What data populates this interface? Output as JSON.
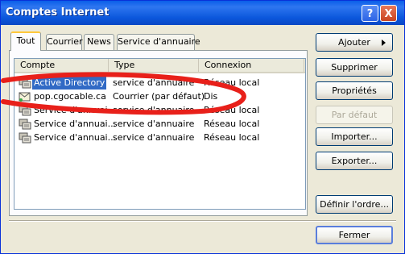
{
  "window": {
    "title": "Comptes Internet"
  },
  "titlebar_buttons": {
    "help": "?",
    "close": "X"
  },
  "tabs": [
    {
      "label": "Tout",
      "active": true
    },
    {
      "label": "Courrier",
      "active": false
    },
    {
      "label": "News",
      "active": false
    },
    {
      "label": "Service d'annuaire",
      "active": false
    }
  ],
  "columns": [
    "Compte",
    "Type",
    "Connexion"
  ],
  "accounts": [
    {
      "name": "Active Directory",
      "type": "service d'annuaire",
      "connection": "Réseau local",
      "selected": true
    },
    {
      "name": "pop.cgocable.ca",
      "type": "Courrier (par défaut)",
      "connection": "Dis",
      "selected": false
    },
    {
      "name": "Service d'annuai...",
      "type": "service d'annuaire",
      "connection": "Réseau local",
      "selected": false
    },
    {
      "name": "Service d'annuai...",
      "type": "service d'annuaire",
      "connection": "Réseau local",
      "selected": false
    },
    {
      "name": "Service d'annuai...",
      "type": "service d'annuaire",
      "connection": "Réseau local",
      "selected": false
    }
  ],
  "buttons": {
    "add": "Ajouter",
    "remove": "Supprimer",
    "properties": "Propriétés",
    "default": "Par défaut",
    "import": "Importer...",
    "export": "Exporter...",
    "order": "Définir l'ordre...",
    "close": "Fermer"
  },
  "annotation_color": "#e8201a"
}
